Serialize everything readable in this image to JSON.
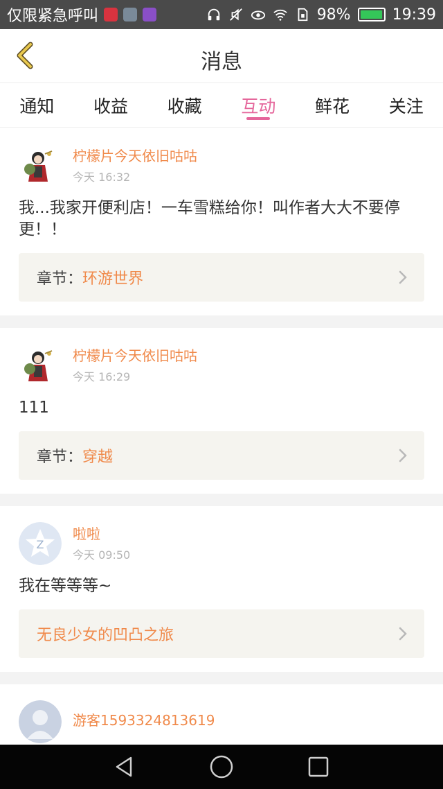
{
  "status_bar": {
    "carrier": "仅限紧急呼叫",
    "battery": "98%",
    "battery_level": 0.98,
    "time": "19:39"
  },
  "header": {
    "title": "消息"
  },
  "tabs": [
    {
      "label": "通知",
      "active": false
    },
    {
      "label": "收益",
      "active": false
    },
    {
      "label": "收藏",
      "active": false
    },
    {
      "label": "互动",
      "active": true
    },
    {
      "label": "鲜花",
      "active": false
    },
    {
      "label": "关注",
      "active": false
    }
  ],
  "messages": [
    {
      "name": "柠檬片今天依旧咕咕",
      "time": "今天 16:32",
      "content": "我...我家开便利店！一车雪糕给你！叫作者大大不要停更！！",
      "ref_label": "章节：",
      "ref_value": "环游世界"
    },
    {
      "name": "柠檬片今天依旧咕咕",
      "time": "今天 16:29",
      "content": "111",
      "ref_label": "章节：",
      "ref_value": "穿越"
    },
    {
      "name": "啦啦",
      "time": "今天 09:50",
      "content": "我在等等等~",
      "ref_label": "",
      "ref_value": "无良少女的凹凸之旅"
    },
    {
      "name": "游客1593324813619",
      "time": "",
      "content": "",
      "ref_label": "",
      "ref_value": ""
    }
  ],
  "colors": {
    "accent_pink": "#e5669b",
    "accent_orange": "#f08a4b",
    "back_arrow": "#e0c050"
  }
}
